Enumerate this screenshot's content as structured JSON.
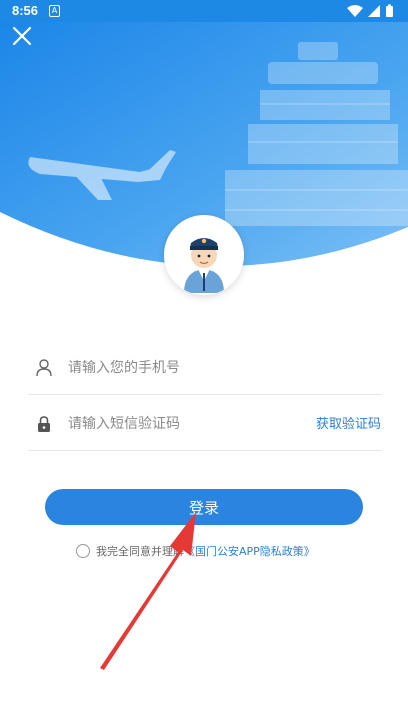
{
  "status_bar": {
    "time": "8:56",
    "app_icon": "A",
    "icons": [
      "wifi-icon",
      "signal-icon",
      "battery-icon"
    ]
  },
  "header": {
    "close_icon": "close-icon",
    "background_colors": [
      "#1e88e5",
      "#64b5f6"
    ]
  },
  "form": {
    "phone": {
      "placeholder": "请输入您的手机号",
      "icon": "user-icon"
    },
    "code": {
      "placeholder": "请输入短信验证码",
      "icon": "lock-icon",
      "get_code_label": "获取验证码"
    },
    "login_label": "登录",
    "agreement": {
      "prefix": "我完全同意并理解",
      "link": "《国门公安APP隐私政策》"
    }
  },
  "colors": {
    "accent": "#2b84e0",
    "link": "#2b7fd6",
    "annotation_arrow": "#e53935"
  }
}
